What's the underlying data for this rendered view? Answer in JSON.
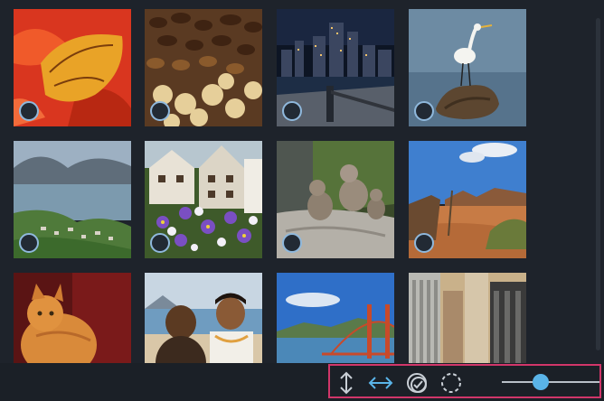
{
  "gallery": {
    "photos": [
      {
        "name": "photo-butterfly",
        "selected": false
      },
      {
        "name": "photo-dates",
        "selected": false
      },
      {
        "name": "photo-city-night",
        "selected": false
      },
      {
        "name": "photo-egret",
        "selected": false
      },
      {
        "name": "photo-lake-town",
        "selected": false
      },
      {
        "name": "photo-flowers-street",
        "selected": false
      },
      {
        "name": "photo-monkeys",
        "selected": false
      },
      {
        "name": "photo-desert-horse",
        "selected": false
      },
      {
        "name": "photo-cat",
        "selected": false
      },
      {
        "name": "photo-couple",
        "selected": false
      },
      {
        "name": "photo-golden-gate",
        "selected": false
      },
      {
        "name": "photo-skyscrapers",
        "selected": false
      }
    ]
  },
  "toolbar": {
    "icons": [
      "vertical-resize-icon",
      "horizontal-resize-icon",
      "select-all-icon",
      "deselect-icon"
    ],
    "zoom_slider_value": 0.4
  },
  "colors": {
    "accent": "#5ab4e8",
    "highlight_border": "#d1366a",
    "background": "#1e232b"
  }
}
